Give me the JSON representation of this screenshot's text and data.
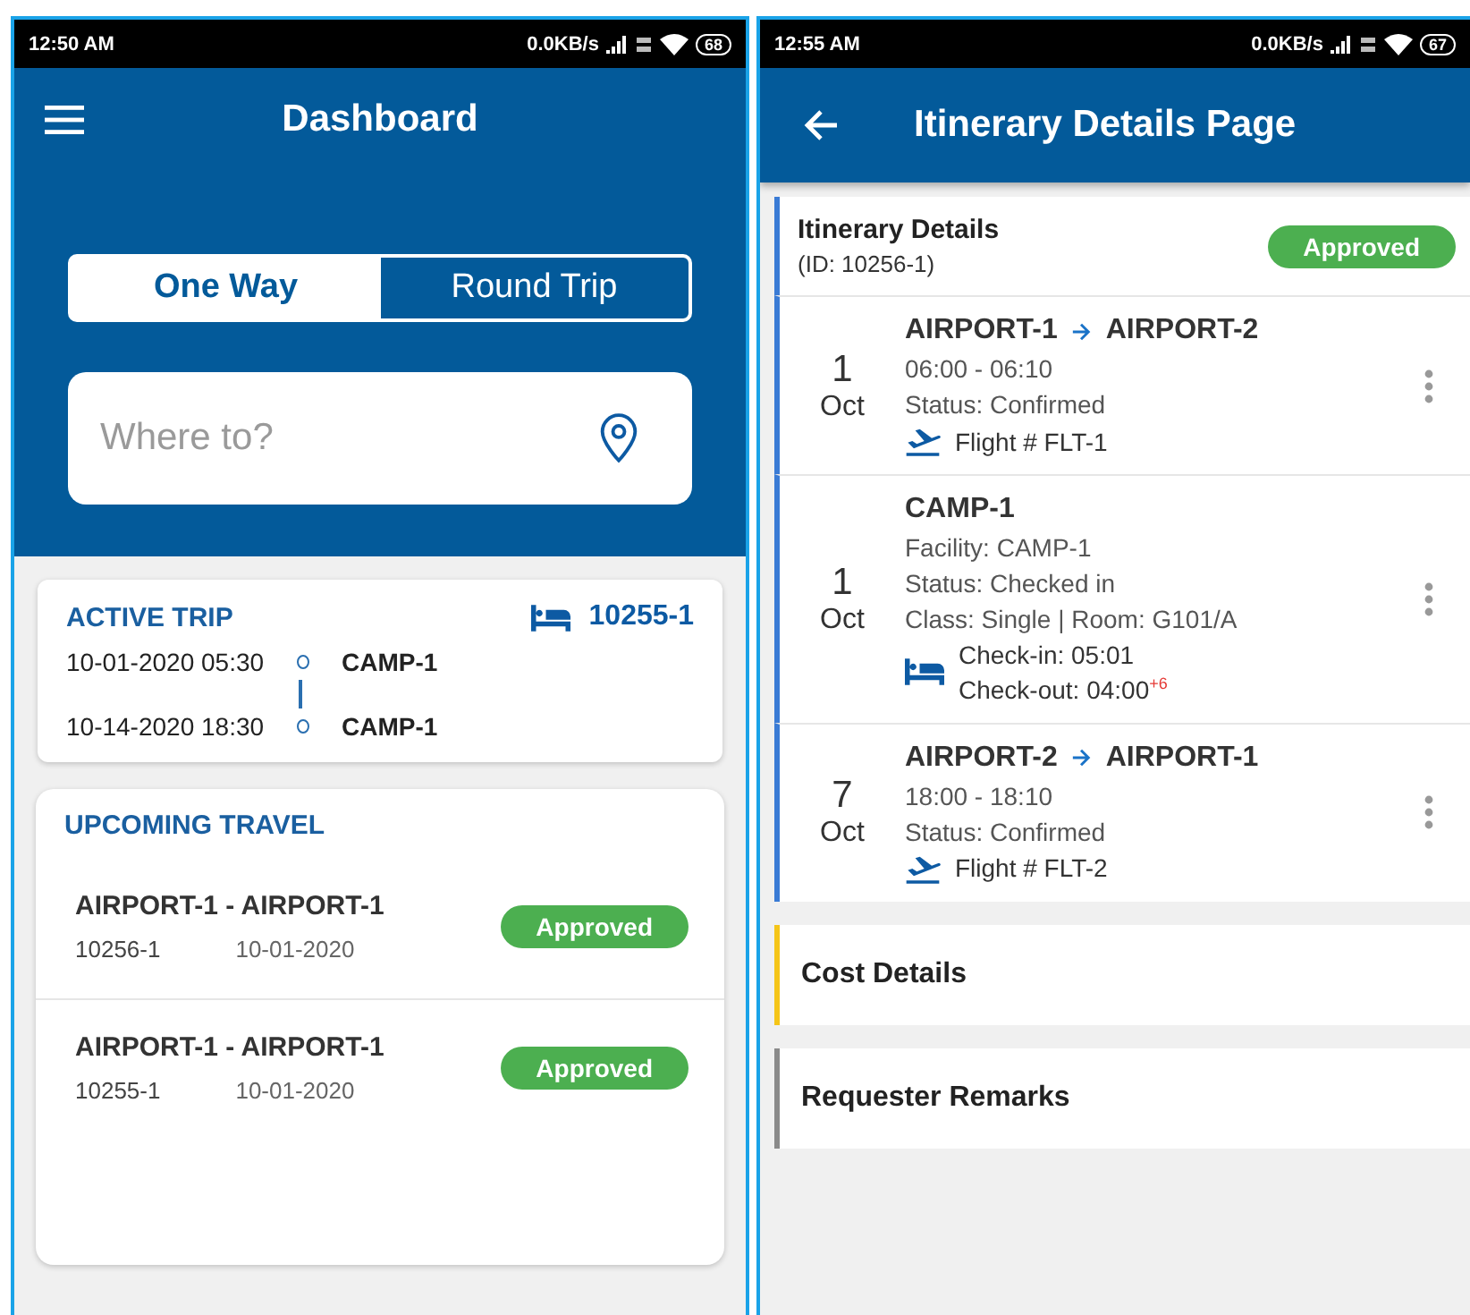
{
  "dashboard_screen": {
    "status_bar": {
      "time": "12:50 AM",
      "speed": "0.0KB/s",
      "battery": "68"
    },
    "title": "Dashboard",
    "trip_type": [
      {
        "label": "One Way",
        "selected": true
      },
      {
        "label": "Round Trip",
        "selected": false
      }
    ],
    "search": {
      "placeholder": "Where to?"
    },
    "active_trip": {
      "heading": "ACTIVE TRIP",
      "booking_id": "10255-1",
      "stops": [
        {
          "datetime": "10-01-2020 05:30",
          "place": "CAMP-1"
        },
        {
          "datetime": "10-14-2020 18:30",
          "place": "CAMP-1"
        }
      ]
    },
    "upcoming_travel": {
      "heading": "UPCOMING TRAVEL",
      "trips": [
        {
          "route": "AIRPORT-1 - AIRPORT-1",
          "id": "10256-1",
          "date": "10-01-2020",
          "status": "Approved"
        },
        {
          "route": "AIRPORT-1 - AIRPORT-1",
          "id": "10255-1",
          "date": "10-01-2020",
          "status": "Approved"
        }
      ]
    }
  },
  "itinerary_screen": {
    "status_bar": {
      "time": "12:55 AM",
      "speed": "0.0KB/s",
      "battery": "67"
    },
    "title": "Itinerary Details Page",
    "header": {
      "title": "Itinerary Details",
      "id": "(ID: 10256-1)",
      "status": "Approved"
    },
    "items": [
      {
        "kind": "flight",
        "day": "1",
        "month": "Oct",
        "from": "AIRPORT-1",
        "to": "AIRPORT-2",
        "lines": [
          "06:00 - 06:10",
          "Status: Confirmed"
        ],
        "detail": "Flight # FLT-1"
      },
      {
        "kind": "hotel",
        "day": "1",
        "month": "Oct",
        "name": "CAMP-1",
        "lines": [
          "Facility: CAMP-1",
          "Status: Checked in",
          "Class: Single | Room: G101/A"
        ],
        "check_in": "Check-in: 05:01",
        "check_out": "Check-out: 04:00$^{+6}$"
      },
      {
        "kind": "flight",
        "day": "7",
        "month": "Oct",
        "from": "AIRPORT-2",
        "to": "AIRPORT-1",
        "lines": [
          "18:00 - 18:10",
          "Status: Confirmed"
        ],
        "detail": "Flight # FLT-2"
      }
    ],
    "sections": [
      {
        "title": "Cost Details",
        "color": "#f5c518"
      },
      {
        "title": "Requester Remarks",
        "color": "#8a8a8a"
      }
    ]
  }
}
